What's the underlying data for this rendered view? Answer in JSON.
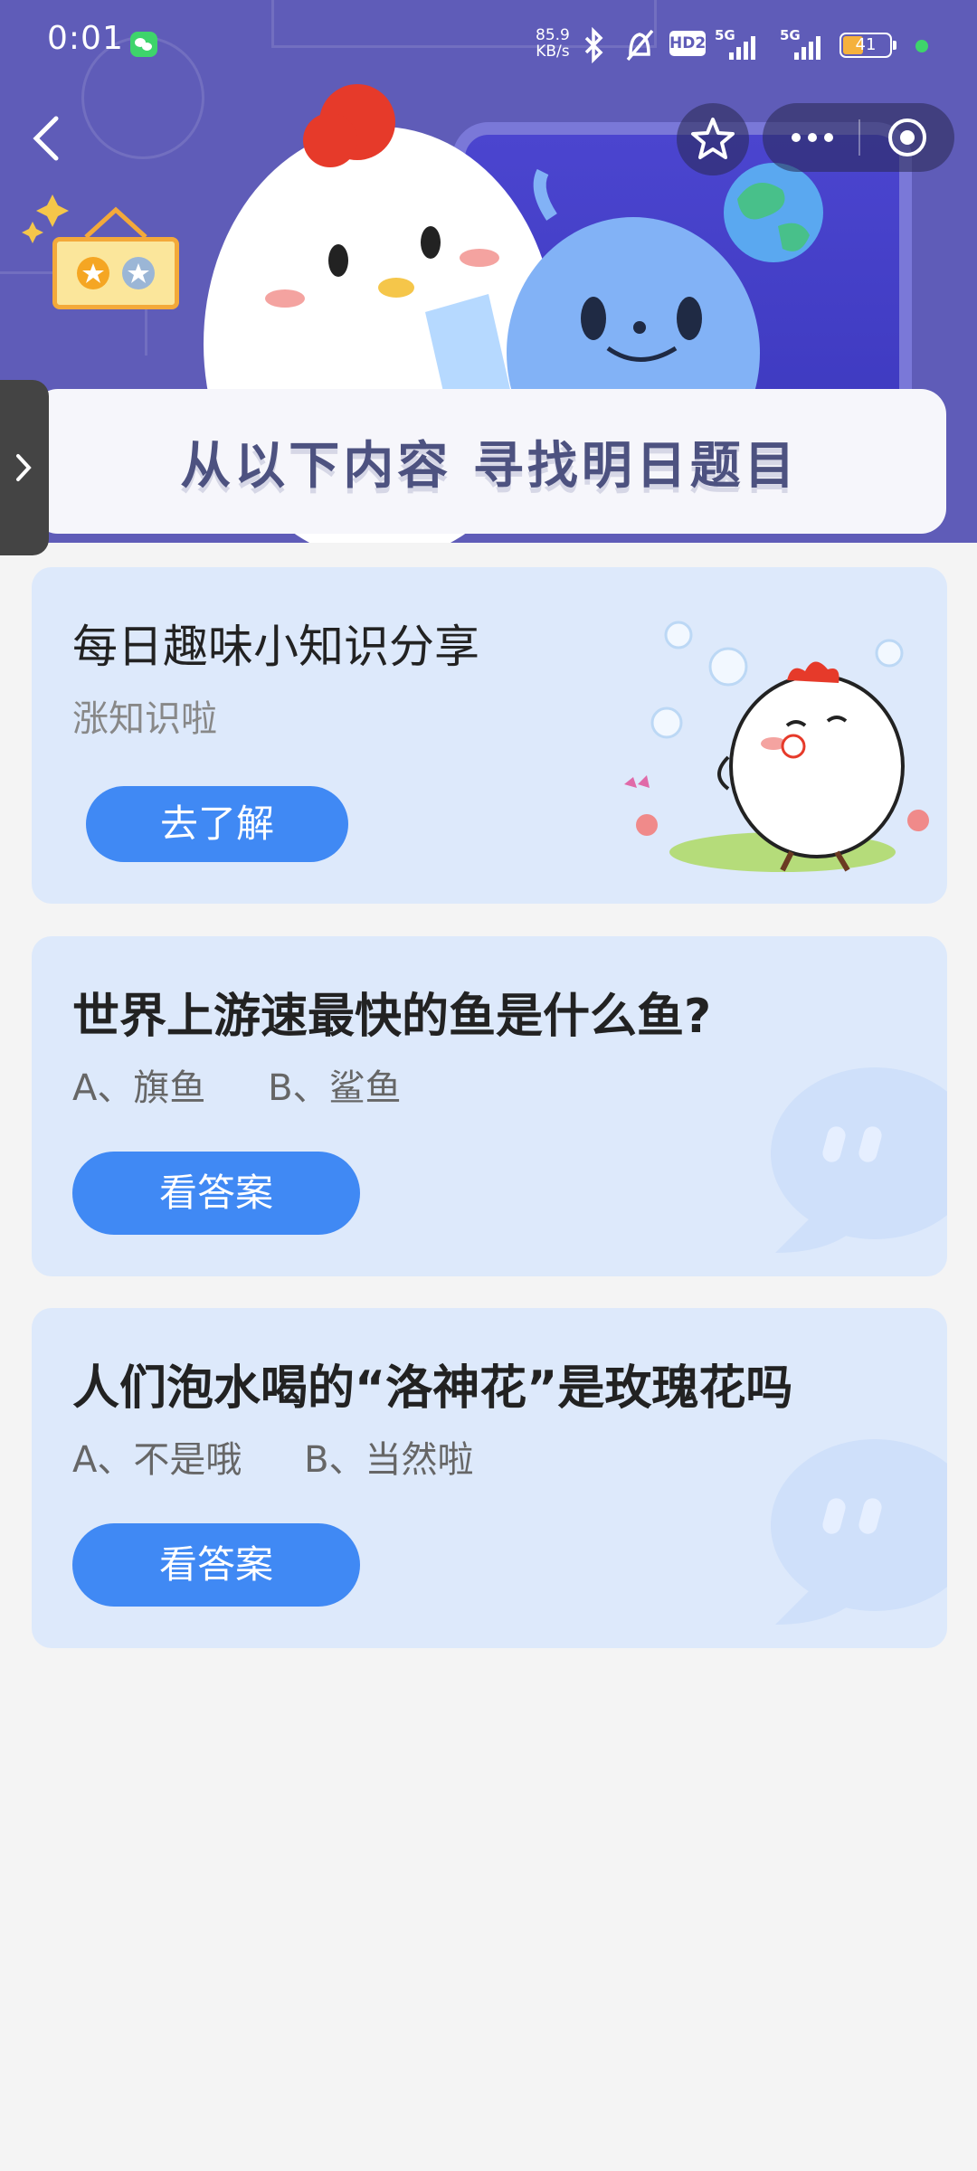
{
  "status_bar": {
    "time": "0:01",
    "net_speed_value": "85.9",
    "net_speed_unit": "KB/s",
    "hd_label": "HD2",
    "signal_label_1": "5G",
    "signal_label_2": "5G",
    "battery": "41"
  },
  "banner": {
    "title": "从以下内容  寻找明日题目"
  },
  "cards": [
    {
      "title": "每日趣味小知识分享",
      "subtitle": "涨知识啦",
      "button": "去了解"
    },
    {
      "question": "世界上游速最快的鱼是什么鱼?",
      "option_a": "A、旗鱼",
      "option_b": "B、鲨鱼",
      "button": "看答案"
    },
    {
      "question": "人们泡水喝的“洛神花”是玫瑰花吗",
      "option_a": "A、不是哦",
      "option_b": "B、当然啦",
      "button": "看答案"
    }
  ],
  "icons": {
    "back": "chevron-left-icon",
    "favorite": "star-icon",
    "more": "more-dots-icon",
    "close": "target-icon",
    "side_tab": "chevron-right-icon"
  },
  "colors": {
    "hero_bg": "#5f5cb8",
    "card_bg": "#dde9fb",
    "button_blue": "#4089f4",
    "page_bg": "#f4f4f4"
  }
}
